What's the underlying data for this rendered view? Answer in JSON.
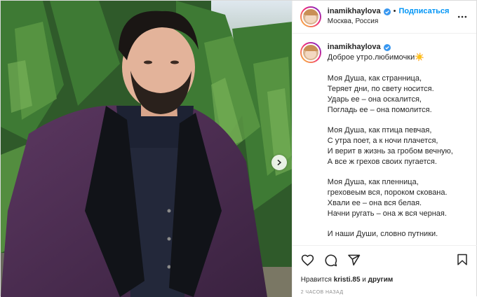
{
  "post": {
    "author": "inamikhaylova",
    "follow_label": "Подписаться",
    "location": "Москва, Россия",
    "caption_intro": "Доброе утро.любимочки",
    "caption_emoji": "☀️",
    "stanzas": [
      [
        "Моя Душа, как странница,",
        "Теряет дни, по свету носится.",
        "Ударь ее – она оскалится,",
        "Погладь ее – она помолится."
      ],
      [
        "Моя Душа, как птица певчая,",
        "С утра поет, а к ночи плачется,",
        "И верит в жизнь за гробом вечную,",
        "А все ж грехов своих пугается."
      ],
      [
        "Моя Душа, как пленница,",
        "греховеым вся, пороком скована.",
        "Хвали ее – она вся белая.",
        "Начни ругать – она ж вся черная."
      ],
      [
        "И наши Души, словно путники."
      ]
    ],
    "likes_prefix": "Нравится",
    "likes_user": "kristi.85",
    "likes_and": "и",
    "likes_others": "другим",
    "time_ago": "2 ЧАСОВ НАЗАД"
  },
  "icons": {
    "verified": "verified-badge-icon",
    "more": "more-options-icon",
    "next": "chevron-right-icon",
    "like": "heart-icon",
    "comment": "comment-icon",
    "share": "share-icon",
    "save": "bookmark-icon"
  },
  "colors": {
    "accent": "#0095f6",
    "jacket": "#4a2c4e",
    "trees": "#2e5d2b"
  }
}
